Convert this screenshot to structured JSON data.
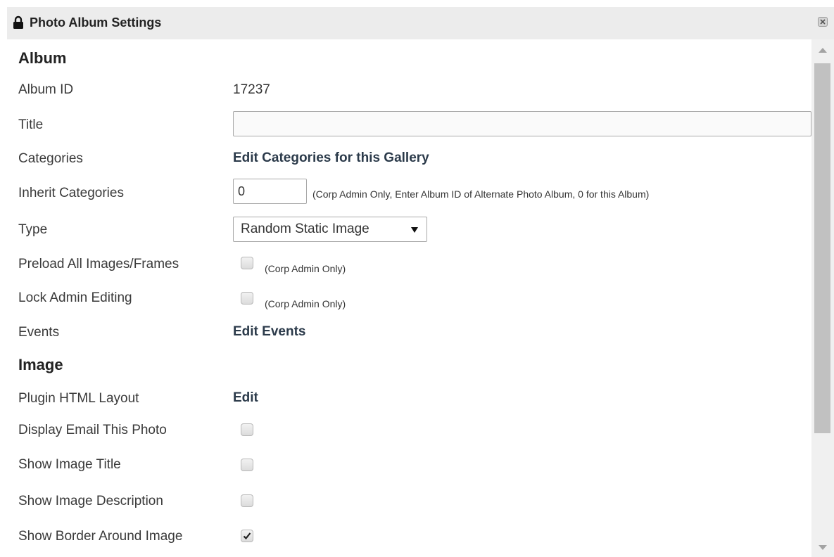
{
  "window": {
    "title": "Photo Album Settings",
    "close_icon": "close-icon",
    "lock_icon": "lock-icon"
  },
  "sections": {
    "album": "Album",
    "image": "Image"
  },
  "album": {
    "album_id_label": "Album ID",
    "album_id_value": "17237",
    "title_label": "Title",
    "title_value": "",
    "categories_label": "Categories",
    "categories_link": "Edit Categories for this Gallery",
    "inherit_label": "Inherit Categories",
    "inherit_value": "0",
    "inherit_note": "(Corp Admin Only, Enter Album ID of Alternate Photo Album, 0 for this Album)",
    "type_label": "Type",
    "type_selected": "Random Static Image",
    "preload_label": "Preload All Images/Frames",
    "preload_checked": false,
    "preload_note": "(Corp Admin Only)",
    "lock_label": "Lock Admin Editing",
    "lock_checked": false,
    "lock_note": "(Corp Admin Only)",
    "events_label": "Events",
    "events_link": "Edit Events"
  },
  "image": {
    "plugin_label": "Plugin HTML Layout",
    "plugin_link": "Edit",
    "email_label": "Display Email This Photo",
    "email_checked": false,
    "title_label": "Show Image Title",
    "title_checked": false,
    "description_label": "Show Image Description",
    "description_checked": false,
    "border_label": "Show Border Around Image",
    "border_checked": true
  }
}
